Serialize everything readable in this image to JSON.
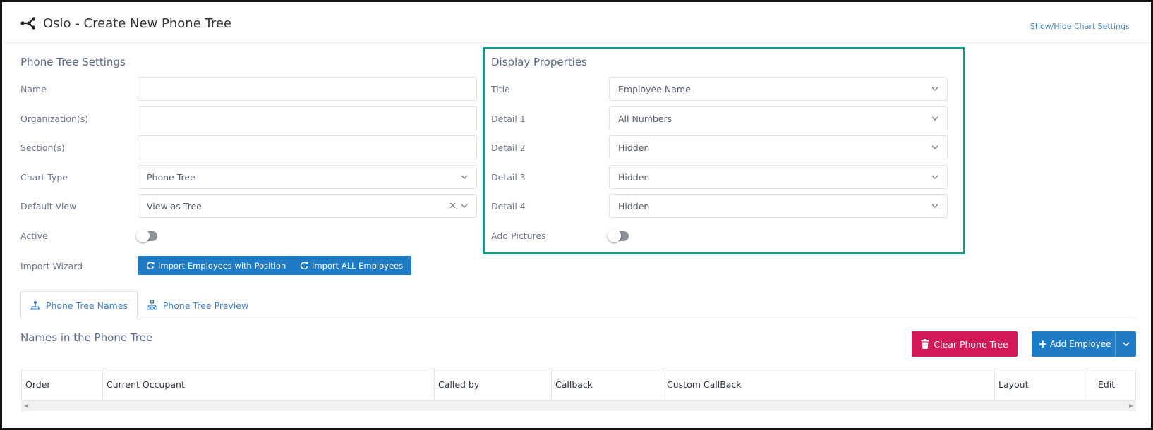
{
  "header": {
    "title": "Oslo - Create New Phone Tree",
    "app_icon": "network-icon",
    "settings_link": "Show/Hide Chart Settings"
  },
  "settings": {
    "title": "Phone Tree Settings",
    "name_label": "Name",
    "name_value": "",
    "org_label": "Organization(s)",
    "org_value": "",
    "section_label": "Section(s)",
    "section_value": "",
    "chart_type_label": "Chart Type",
    "chart_type_value": "Phone Tree",
    "default_view_label": "Default View",
    "default_view_value": "View as Tree",
    "active_label": "Active",
    "active_on": false,
    "import_label": "Import Wizard",
    "import_position_btn": "Import Employees with Position",
    "import_all_btn": "Import ALL Employees"
  },
  "display": {
    "title": "Display Properties",
    "title_label": "Title",
    "title_value": "Employee Name",
    "detail1_label": "Detail 1",
    "detail1_value": "All Numbers",
    "detail2_label": "Detail 2",
    "detail2_value": "Hidden",
    "detail3_label": "Detail 3",
    "detail3_value": "Hidden",
    "detail4_label": "Detail 4",
    "detail4_value": "Hidden",
    "pictures_label": "Add Pictures",
    "pictures_on": false,
    "highlight_color": "#15998a"
  },
  "tabs": [
    {
      "label": "Phone Tree Names",
      "icon": "person-sitemap-icon",
      "active": true
    },
    {
      "label": "Phone Tree Preview",
      "icon": "sitemap-icon",
      "active": false
    }
  ],
  "names": {
    "title": "Names in the Phone Tree",
    "clear_btn": "Clear Phone Tree",
    "add_btn": "Add Employee"
  },
  "table": {
    "columns": [
      "Order",
      "Current Occupant",
      "Called by",
      "Callback",
      "Custom CallBack",
      "Layout",
      "Edit"
    ]
  },
  "colors": {
    "primary": "#1f7bc4",
    "danger": "#d2195a",
    "section_title": "#5b6a8c"
  }
}
